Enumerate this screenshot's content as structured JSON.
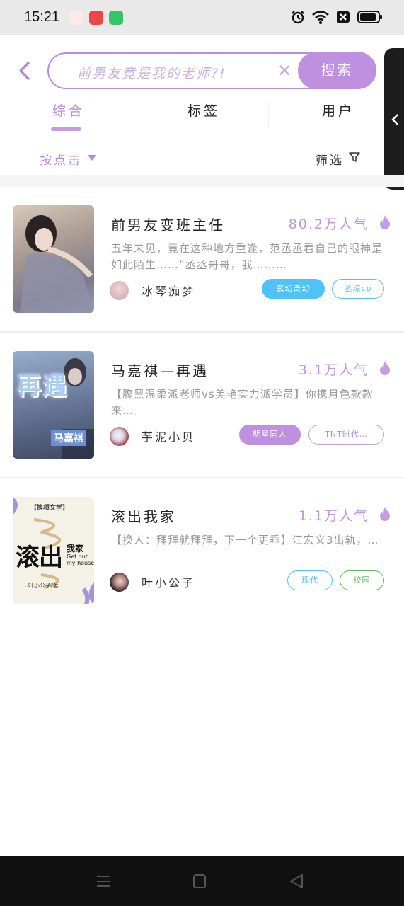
{
  "status_bar": {
    "time": "15:21"
  },
  "header": {
    "search_placeholder": "前男友竟是我的老师?!",
    "search_button": "搜索",
    "clear_icon": "close-icon"
  },
  "tabs": [
    {
      "label": "综合",
      "active": true
    },
    {
      "label": "标签",
      "active": false
    },
    {
      "label": "用户",
      "active": false
    }
  ],
  "sort_label": "按点击",
  "filter_label": "筛选",
  "colors": {
    "accent": "#bf8fe0",
    "accent_light": "#c59ce4",
    "cyan": "#4fc3f7",
    "green": "#5cb85c"
  },
  "results": [
    {
      "title": "前男友变班主任",
      "popularity": "80.2万人气",
      "description": "五年未见，竟在这种地方重逢，范丞丞看自己的眼神是如此陌生……“丞丞哥哥，我………",
      "author": "冰琴痴梦",
      "tags": [
        "玄幻奇幻",
        "丞琼cp"
      ]
    },
    {
      "title": "马嘉祺—再遇",
      "popularity": "3.1万人气",
      "description": "【腹黑温柔派老师vs美艳实力派学员】你携月色款款来…",
      "author": "芋泥小贝",
      "tags": [
        "明星同人",
        "TNT时代…"
      ]
    },
    {
      "title": "滚出我家",
      "popularity": "1.1万人气",
      "description": "【换人：拜拜就拜拜，下一个更乖】江宏义3出轨，…",
      "author": "叶小公子",
      "tags": [
        "现代",
        "校园"
      ]
    }
  ],
  "covers": {
    "cover2_text": "再遇",
    "cover2_name": "马嘉祺",
    "cover3_brand": "【换项文学】",
    "cover3_title": "滚出",
    "cover3_sub": "我家",
    "cover3_en": "Get out my house",
    "cover3_author": "叶小公子/著"
  }
}
